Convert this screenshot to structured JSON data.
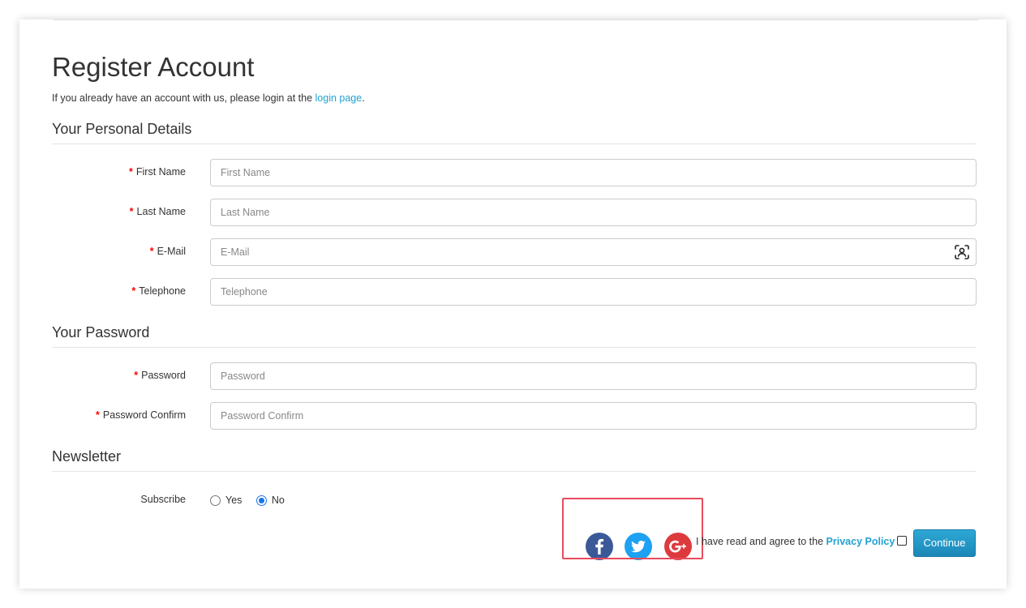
{
  "page": {
    "title": "Register Account",
    "intro_prefix": "If you already have an account with us, please login at the ",
    "intro_link": "login page",
    "intro_suffix": "."
  },
  "personal": {
    "legend": "Your Personal Details",
    "fields": [
      {
        "label": "First Name",
        "placeholder": "First Name"
      },
      {
        "label": "Last Name",
        "placeholder": "Last Name"
      },
      {
        "label": "E-Mail",
        "placeholder": "E-Mail"
      },
      {
        "label": "Telephone",
        "placeholder": "Telephone"
      }
    ]
  },
  "password": {
    "legend": "Your Password",
    "fields": [
      {
        "label": "Password",
        "placeholder": "Password"
      },
      {
        "label": "Password Confirm",
        "placeholder": "Password Confirm"
      }
    ]
  },
  "newsletter": {
    "legend": "Newsletter",
    "label": "Subscribe",
    "options": [
      "Yes",
      "No"
    ],
    "selected": "No"
  },
  "footer": {
    "agree_text": "I have read and agree to the ",
    "privacy_link": "Privacy Policy",
    "continue_label": "Continue"
  },
  "required_marker": "*",
  "colors": {
    "link": "#23a1d1",
    "required": "#ff0000",
    "facebook": "#3b5998",
    "twitter": "#1da1f2",
    "google": "#dd3a3e",
    "highlight": "#e94b5c"
  },
  "icons": [
    "facebook-icon",
    "twitter-icon",
    "google-plus-icon",
    "autofill-contact-icon"
  ]
}
